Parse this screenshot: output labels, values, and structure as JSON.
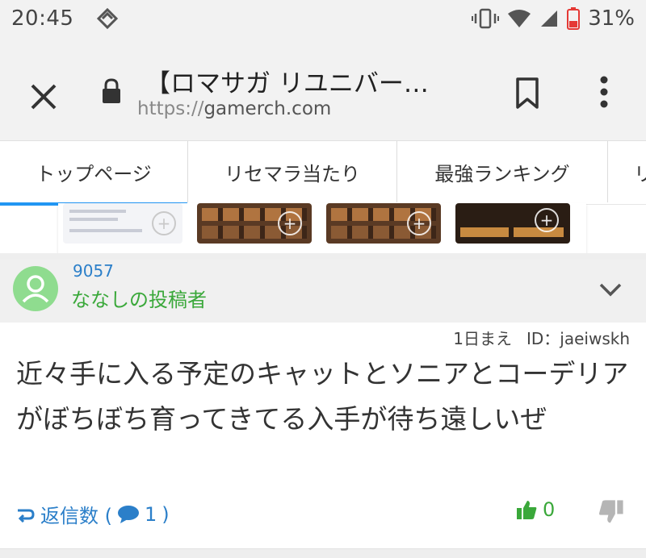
{
  "status_bar": {
    "time": "20:45",
    "battery_percent": "31%"
  },
  "address_bar": {
    "title": "【ロマサガ リユニバー…",
    "url_scheme": "https://",
    "url_host": "gamerch.com"
  },
  "tabs": [
    {
      "label": "トップページ",
      "active": true
    },
    {
      "label": "リセマラ当たり",
      "active": false
    },
    {
      "label": "最強ランキング",
      "active": false
    },
    {
      "label": "リ",
      "active": false
    }
  ],
  "comment": {
    "number": "9057",
    "author": "ななしの投稿者",
    "posted": "1日まえ",
    "user_id": "ID：jaeiwskh",
    "body": "近々手に入る予定のキャットとソニアとコーデリアがぼちぼち育ってきてる入手が待ち遠しいぜ",
    "reply_label": "返信数 (",
    "reply_count": "1",
    "reply_suffix": ")",
    "like_count": "0"
  },
  "colors": {
    "accent_blue": "#2196f3",
    "link_blue": "#2b7fc9",
    "author_green": "#3aa83a",
    "battery_red": "#e53935"
  }
}
